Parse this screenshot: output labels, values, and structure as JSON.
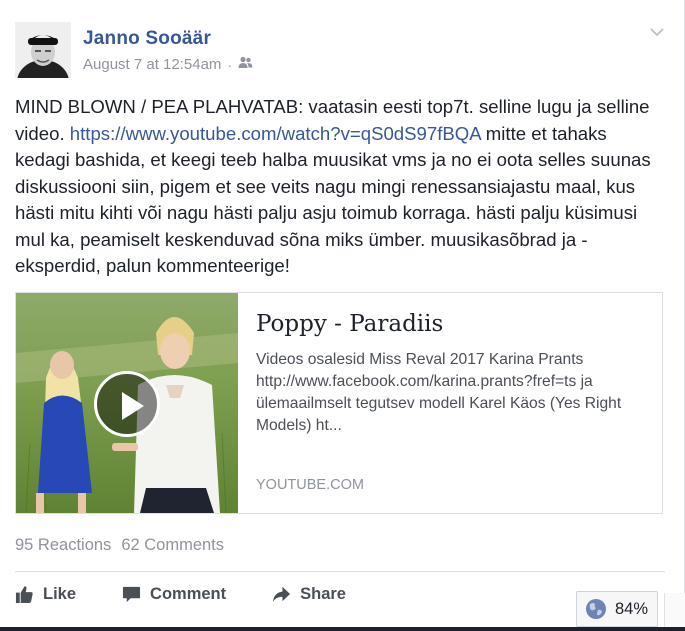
{
  "post": {
    "author": "Janno Sooäär",
    "timestamp": "August 7 at 12:54am",
    "separator": "·",
    "audience_icon": "friends-icon",
    "text_before_link": "MIND BLOWN / PEA PLAHVATAB: vaatasin eesti top7t. selline lugu ja selline video. ",
    "link": "https://www.youtube.com/watch?v=qS0dS97fBQA",
    "text_after_link": " mitte et tahaks kedagi bashida, et keegi teeb halba muusikat vms ja no ei oota selles suunas diskussiooni siin, pigem et see veits nagu mingi renessansiajastu maal, kus hästi mitu kihti või nagu hästi palju asju toimub korraga. hästi palju küsimusi mul ka, peamiselt keskenduvad sõna miks ümber. muusikasõbrad ja -eksperdid, palun kommenteerige!"
  },
  "link_card": {
    "title": "Poppy - Paradiis",
    "description": "Videos osalesid Miss Reval 2017 Karina Prants http://www.facebook.com/karina.prants?fref=ts ja ülemaailmselt tegutsev modell Karel Käos (Yes Right Models) ht...",
    "domain": "YOUTUBE.COM"
  },
  "stats": {
    "reactions": "95 Reactions",
    "comments": "62 Comments"
  },
  "actions": {
    "like": "Like",
    "comment": "Comment",
    "share": "Share"
  },
  "zoom": {
    "label": "84%"
  },
  "colors": {
    "name_blue": "#365899",
    "link_blue": "#365899",
    "meta_gray": "#90949c",
    "action_gray": "#4b4f56"
  }
}
